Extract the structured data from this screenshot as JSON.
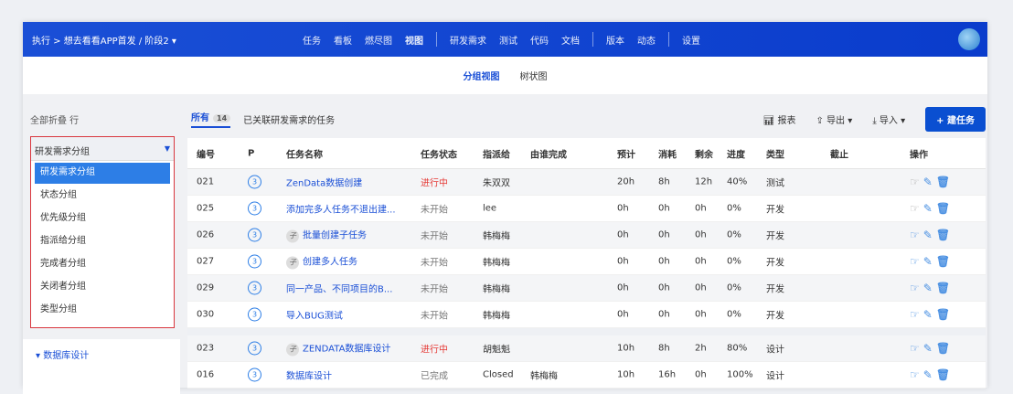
{
  "header": {
    "breadcrumb": "执行 > 想去看看APP首发 / 阶段2 ▾",
    "nav": [
      "任务",
      "看板",
      "燃尽图",
      "视图",
      "研发需求",
      "测试",
      "代码",
      "文档",
      "版本",
      "动态",
      "设置"
    ]
  },
  "subnav": [
    "分组视图",
    "树状图"
  ],
  "left": {
    "fold_all": "全部折叠 行",
    "group_by": "研发需求分组",
    "options": [
      "研发需求分组",
      "状态分组",
      "优先级分组",
      "指派给分组",
      "完成者分组",
      "关闭者分组",
      "类型分组"
    ],
    "group_name": "▾ 数据库设计"
  },
  "tabs": {
    "all": "所有",
    "all_count": "14",
    "linked": "已关联研发需求的任务"
  },
  "toolbar": {
    "report": "报表",
    "export": "导出 ▾",
    "import": "导入 ▾",
    "create": "+ 建任务"
  },
  "columns": [
    "编号",
    "P",
    "任务名称",
    "任务状态",
    "指派给",
    "由谁完成",
    "预计",
    "消耗",
    "剩余",
    "进度",
    "类型",
    "截止",
    "操作"
  ],
  "rows": [
    {
      "id": "021",
      "p": "3",
      "sub": "",
      "name": "ZenData数据创建",
      "status": "进行中",
      "assign": "朱双双",
      "done": "",
      "est": "20h",
      "cons": "8h",
      "left": "12h",
      "prog": "40%",
      "type": "测试"
    },
    {
      "id": "025",
      "p": "3",
      "sub": "",
      "name": "添加完多人任务不退出建...",
      "status": "未开始",
      "assign": "lee",
      "done": "",
      "est": "0h",
      "cons": "0h",
      "left": "0h",
      "prog": "0%",
      "type": "开发"
    },
    {
      "id": "026",
      "p": "3",
      "sub": "子",
      "name": "批量创建子任务",
      "status": "未开始",
      "assign": "韩梅梅",
      "done": "",
      "est": "0h",
      "cons": "0h",
      "left": "0h",
      "prog": "0%",
      "type": "开发"
    },
    {
      "id": "027",
      "p": "3",
      "sub": "子",
      "name": "创建多人任务",
      "status": "未开始",
      "assign": "韩梅梅",
      "done": "",
      "est": "0h",
      "cons": "0h",
      "left": "0h",
      "prog": "0%",
      "type": "开发"
    },
    {
      "id": "029",
      "p": "3",
      "sub": "",
      "name": "同一产品、不同项目的B...",
      "status": "未开始",
      "assign": "韩梅梅",
      "done": "",
      "est": "0h",
      "cons": "0h",
      "left": "0h",
      "prog": "0%",
      "type": "开发"
    },
    {
      "id": "030",
      "p": "3",
      "sub": "",
      "name": "导入BUG测试",
      "status": "未开始",
      "assign": "韩梅梅",
      "done": "",
      "est": "0h",
      "cons": "0h",
      "left": "0h",
      "prog": "0%",
      "type": "开发"
    },
    {
      "id": "023",
      "p": "3",
      "sub": "子",
      "name": "ZENDATA数据库设计",
      "status": "进行中",
      "assign": "胡魁魁",
      "done": "",
      "est": "10h",
      "cons": "8h",
      "left": "2h",
      "prog": "80%",
      "type": "设计"
    },
    {
      "id": "016",
      "p": "3",
      "sub": "",
      "name": "数据库设计",
      "status": "已完成",
      "assign": "Closed",
      "done": "韩梅梅",
      "est": "10h",
      "cons": "16h",
      "left": "0h",
      "prog": "100%",
      "type": "设计"
    }
  ]
}
